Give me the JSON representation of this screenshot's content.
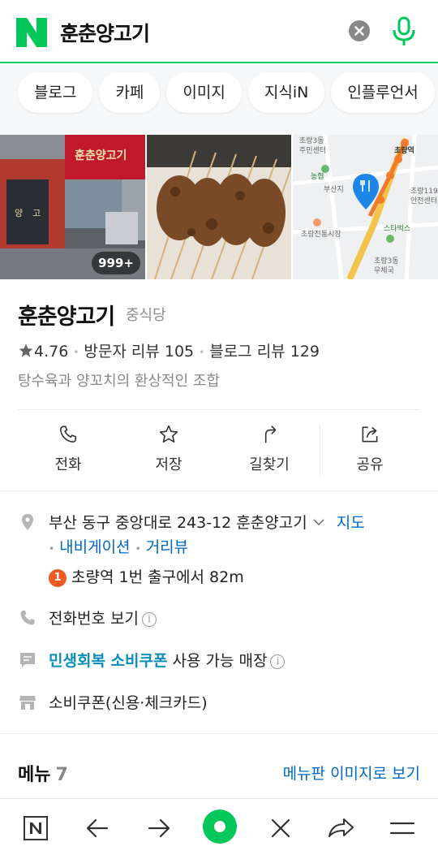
{
  "search": {
    "query": "훈춘양고기"
  },
  "chips": [
    "블로그",
    "카페",
    "이미지",
    "지식iN",
    "인플루언서"
  ],
  "images": {
    "count_badge": "999+"
  },
  "place": {
    "name": "훈춘양고기",
    "category": "중식당",
    "rating": "4.76",
    "visitor_reviews": "방문자 리뷰 105",
    "blog_reviews": "블로그 리뷰 129",
    "description": "탕수육과 양꼬치의 환상적인 조합"
  },
  "actions": {
    "call": "전화",
    "save": "저장",
    "directions": "길찾기",
    "share": "공유"
  },
  "details": {
    "address": "부산 동구 중앙대로 243-12 훈춘양고기",
    "map_link": "지도",
    "navigation_link": "내비게이션",
    "streetview_link": "거리뷰",
    "station_number": "1",
    "station_text": "초량역 1번 출구에서 82m",
    "phone_text": "전화번호 보기",
    "coupon_highlight": "민생회복 소비쿠폰",
    "coupon_text": "사용 가능 매장",
    "coupon_card": "소비쿠폰(신용·체크카드)"
  },
  "menu": {
    "title": "메뉴",
    "count": "7",
    "image_link": "메뉴판 이미지로 보기"
  },
  "map_labels": {
    "station": "초량역",
    "busan_station": "부산지",
    "market": "초량전통시장",
    "starbucks": "스타벅스",
    "center_1": "초량3동",
    "center_2": "주민센터",
    "center_3": "초량119",
    "center_4": "안전센터",
    "post_1": "초량3동",
    "post_2": "우체국",
    "bank": "농협"
  },
  "colors": {
    "brand_green": "#03c75a",
    "link_blue": "#0068c3",
    "station_orange": "#f15a24"
  }
}
